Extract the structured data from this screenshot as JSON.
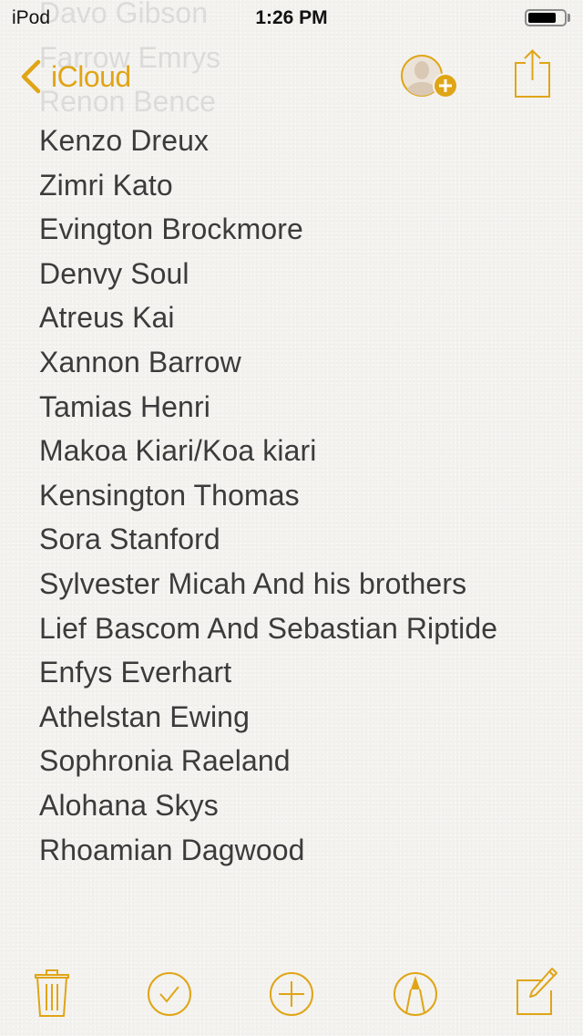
{
  "status_bar": {
    "carrier": "iPod",
    "time": "1:26 PM",
    "battery_level": 0.8
  },
  "nav": {
    "back_label": "iCloud",
    "back_icon": "chevron-left-icon",
    "add_people_icon": "add-person-icon",
    "share_icon": "share-icon"
  },
  "note": {
    "scrolled_lines": [
      "Davo Gibson",
      "Farrow Emrys",
      "Renon Bence"
    ],
    "lines": [
      "Kenzo Dreux",
      "Zimri Kato",
      "Evington Brockmore",
      "Denvy Soul",
      "Atreus Kai",
      "Xannon Barrow",
      "Tamias Henri",
      "Makoa Kiari/Koa kiari",
      "Kensington Thomas",
      "Sora Stanford",
      "Sylvester Micah And his brothers",
      "Lief Bascom And Sebastian Riptide",
      "Enfys Everhart",
      "Athelstan Ewing",
      "Sophronia Raeland",
      "Alohana Skys",
      "Rhoamian Dagwood"
    ]
  },
  "toolbar": {
    "items": [
      {
        "name": "delete",
        "icon": "trash-icon"
      },
      {
        "name": "checklist",
        "icon": "checkmark-circle-icon"
      },
      {
        "name": "add",
        "icon": "plus-circle-icon"
      },
      {
        "name": "sketch",
        "icon": "pen-tip-circle-icon"
      },
      {
        "name": "compose",
        "icon": "compose-icon"
      }
    ]
  },
  "colors": {
    "accent": "#e0a516",
    "text": "#3b3b3b",
    "background": "#f3f2ef"
  }
}
